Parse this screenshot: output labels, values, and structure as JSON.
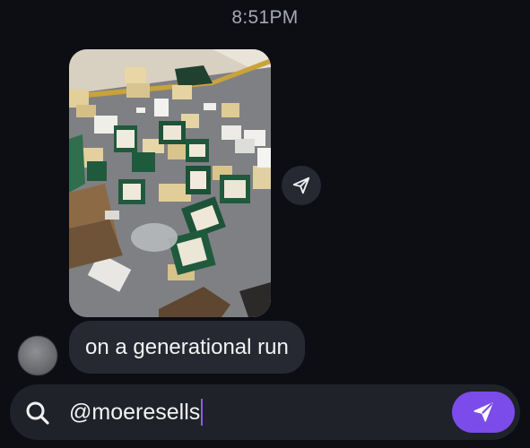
{
  "chat": {
    "timestamp": "8:51PM",
    "messages": [
      {
        "type": "image",
        "icons": [
          "share-icon"
        ]
      },
      {
        "type": "text",
        "text": "on a generational run"
      }
    ]
  },
  "composer": {
    "value": "@moeresells",
    "icons": {
      "search": "search-icon",
      "send": "send-icon"
    },
    "accent_color": "#7b4ce9"
  },
  "theme": {
    "background": "#0c0e14",
    "bubble": "#262932",
    "composer_background": "#1f2229"
  }
}
